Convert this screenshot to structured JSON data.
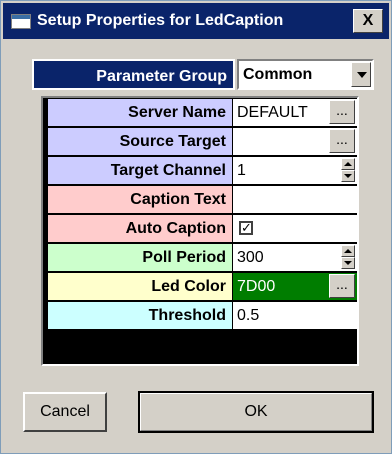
{
  "window": {
    "title": "Setup Properties for LedCaption",
    "close_label": "X"
  },
  "parameter_group": {
    "label": "Parameter Group",
    "value": "Common"
  },
  "properties": [
    {
      "label": "Server Name",
      "value": "DEFAULT",
      "color": "#ccccff",
      "editor": "ellipsis"
    },
    {
      "label": "Source Target",
      "value": "",
      "color": "#ccccff",
      "editor": "ellipsis"
    },
    {
      "label": "Target Channel",
      "value": "1",
      "color": "#ccccff",
      "editor": "spin"
    },
    {
      "label": "Caption Text",
      "value": "",
      "color": "#ffcccc",
      "editor": "text"
    },
    {
      "label": "Auto Caption",
      "value": "✓",
      "color": "#ffcccc",
      "editor": "checkbox"
    },
    {
      "label": "Poll Period",
      "value": "300",
      "color": "#ccffcc",
      "editor": "spin"
    },
    {
      "label": "Led Color",
      "value": "7D00",
      "color": "#ffffcc",
      "editor": "color",
      "swatch": "#007d00"
    },
    {
      "label": "Threshold",
      "value": "0.5",
      "color": "#ccffff",
      "editor": "text"
    }
  ],
  "ellipsis_label": "...",
  "buttons": {
    "cancel": "Cancel",
    "ok": "OK"
  },
  "colors": {
    "title_bar": "#0a246a",
    "dialog_bg": "#d4d0c8"
  }
}
